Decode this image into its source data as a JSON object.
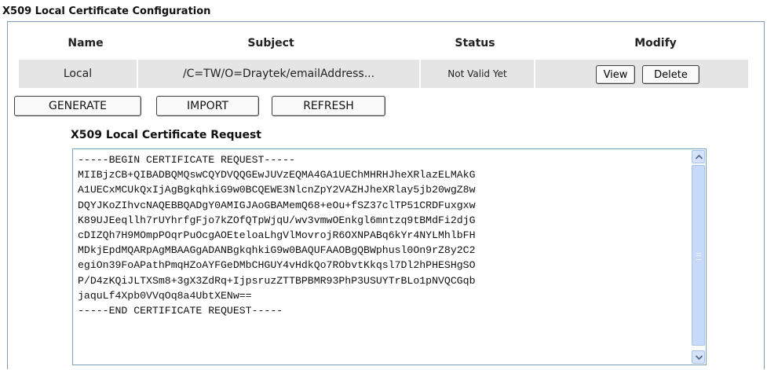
{
  "page_title": "X509 Local Certificate Configuration",
  "table": {
    "headers": [
      "Name",
      "Subject",
      "Status",
      "Modify"
    ],
    "row": {
      "name": "Local",
      "subject": "/C=TW/O=Draytek/emailAddress...",
      "status": "Not Valid Yet",
      "view_label": "View",
      "delete_label": "Delete"
    }
  },
  "actions": {
    "generate_label": "GENERATE",
    "import_label": "IMPORT",
    "refresh_label": "REFRESH"
  },
  "request": {
    "title": "X509 Local Certificate Request",
    "text": "-----BEGIN CERTIFICATE REQUEST-----\nMIIBjzCB+QIBADBQMQswCQYDVQQGEwJUVzEQMA4GA1UEChMHRHJheXRlazELMAkG\nA1UECxMCUkQxIjAgBgkqhkiG9w0BCQEWE3NlcnZpY2VAZHJheXRlay5jb20wgZ8w\nDQYJKoZIhvcNAQEBBQADgY0AMIGJAoGBAMemQ68+eOu+fSZ37clTP51CRDFuxgxw\nK89UJEeqllh7rUYhrfgFjo7kZOfQTpWjqU/wv3vmwOEnkgl6mntzq9tBMdFi2djG\ncDIZQh7H9MOmpPOqrPuOcgAOEteloaLhgVlMovrojR6OXNPABq6kYr4NYLMhlbFH\nMDkjEpdMQARpAgMBAAGgADANBgkqhkiG9w0BAQUFAAOBgQBWphusl0On9rZ8y2C2\negiOn39FoAPathPmqHZoAYFGeDMbCHGUY4vHdkQo7RObvtKkqsl7Dl2hPHESHgSO\nP/D4zKQiJLTXSm8+3gX3ZdRq+IjpsruzZTTBPBMR93PhP3USUYTrBLo1pNVQCGqb\njaquLf4Xpb0VVqOq8a4UbtXENw==\n-----END CERTIFICATE REQUEST-----"
  },
  "icons": {
    "scroll_up": "chevron-up-icon",
    "scroll_down": "chevron-down-icon"
  },
  "colors": {
    "frame_border": "#7f99b3",
    "row_background": "#e5e5e5",
    "scrollbar": "#c7dafa"
  }
}
